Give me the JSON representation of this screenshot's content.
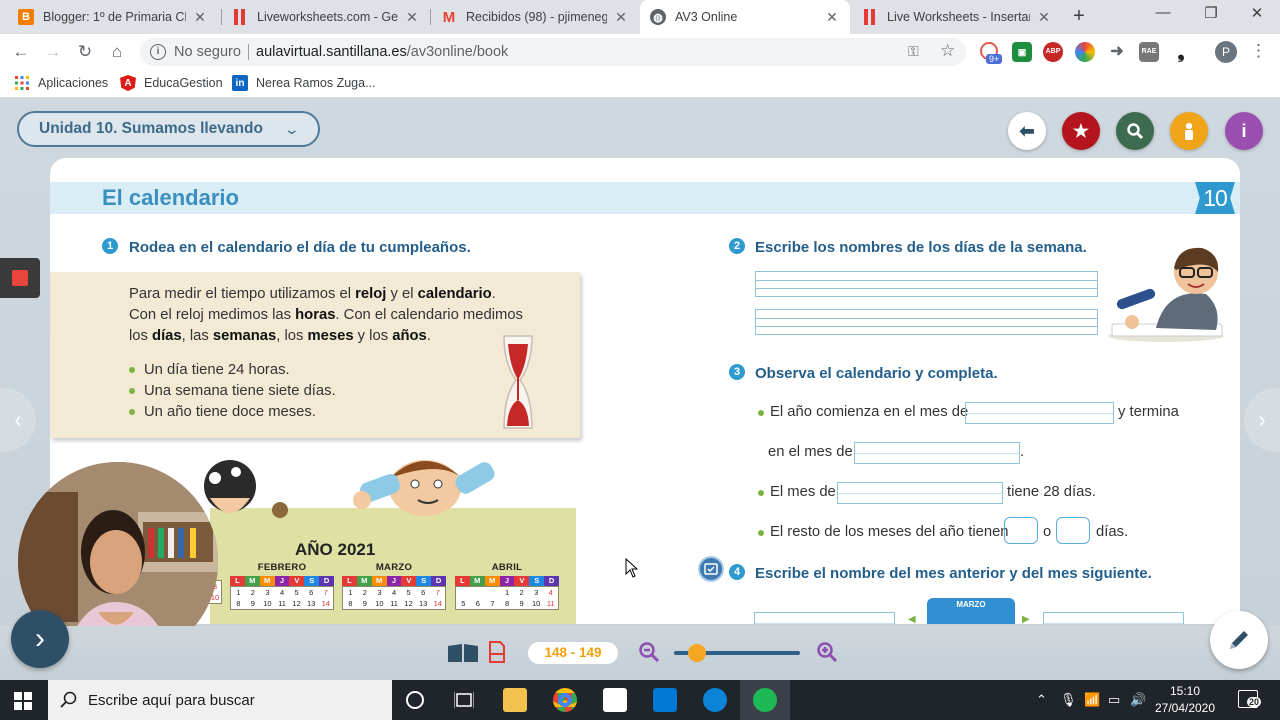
{
  "browser": {
    "tabs": [
      {
        "title": "Blogger: 1º de Primaria CP f",
        "favicon": "blogger-icon",
        "color": "#f57d00",
        "active": false
      },
      {
        "title": "Liveworksheets.com - Gene",
        "favicon": "liveworksheets-icon",
        "color": "#e53935",
        "active": false
      },
      {
        "title": "Recibidos (98) - pjimenegar",
        "favicon": "gmail-icon",
        "color": "#ea4335",
        "active": false
      },
      {
        "title": "AV3 Online",
        "favicon": "globe-icon",
        "color": "#5f6368",
        "active": true
      },
      {
        "title": "Live Worksheets - Insertar P",
        "favicon": "liveworksheets-icon",
        "color": "#e53935",
        "active": false
      }
    ],
    "address": {
      "security": "No seguro",
      "host": "aulavirtual.santillana.es",
      "path": "/av3online/book"
    },
    "extensions": {
      "badge": "9+",
      "abp": "ABP"
    },
    "profile_initial": "P",
    "bookmarks": [
      {
        "label": "Aplicaciones",
        "icon": "apps-grid-icon"
      },
      {
        "label": "EducaGestion",
        "icon": "angular-icon"
      },
      {
        "label": "Nerea Ramos Zuga...",
        "icon": "linkedin-icon"
      }
    ]
  },
  "app": {
    "unit_selector": "Unidad 10. Sumamos llevando",
    "top_buttons": [
      {
        "name": "back",
        "icon": "arrow-left-icon",
        "color": "#ffffff"
      },
      {
        "name": "favorites",
        "icon": "star-icon",
        "color": "#b3141d"
      },
      {
        "name": "search",
        "icon": "search-icon",
        "color": "#3d6b4f"
      },
      {
        "name": "user",
        "icon": "person-icon",
        "color": "#f0a418"
      },
      {
        "name": "info",
        "icon": "info-icon",
        "color": "#9b4fb0"
      }
    ],
    "page_title": "El calendario",
    "unit_number": "10",
    "exercises": {
      "ex1": {
        "number": "1",
        "prompt": "Rodea en el calendario el día de tu cumpleaños."
      },
      "ex2": {
        "number": "2",
        "prompt": "Escribe los nombres de los días de la semana."
      },
      "ex3": {
        "number": "3",
        "prompt": "Observa el calendario y completa.",
        "s1a": "El año comienza en el mes de",
        "s1b": "y termina",
        "s1c": "en el mes de",
        "s1d": ".",
        "s2a": "El mes de",
        "s2b": "tiene 28 días.",
        "s3a": "El resto de los meses del año tienen",
        "s3b": "o",
        "s3c": "días."
      },
      "ex4": {
        "number": "4",
        "prompt": "Escribe el nombre del mes anterior y del mes siguiente.",
        "mini_month": "MARZO"
      }
    },
    "info": {
      "l1a": "Para medir el tiempo utilizamos el ",
      "l1b": "reloj",
      "l1c": " y el ",
      "l1d": "calendario",
      "l1e": ".",
      "l2a": "Con el reloj medimos las ",
      "l2b": "horas",
      "l2c": ". Con el calendario medimos",
      "l3a": "los ",
      "l3b": "días",
      "l3c": ", las ",
      "l3d": "semanas",
      "l3e": ", los ",
      "l3f": "meses",
      "l3g": " y los ",
      "l3h": "años",
      "l3i": ".",
      "bullets": [
        "Un día tiene 24 horas.",
        "Una semana tiene siete días.",
        "Un año tiene doce meses."
      ]
    },
    "calendar": {
      "year": "AÑO 2021",
      "weekdays": [
        "L",
        "M",
        "M",
        "J",
        "V",
        "S",
        "D"
      ],
      "weekday_colors": [
        "#e53935",
        "#43a047",
        "#fb8c00",
        "#8e24aa",
        "#e53935",
        "#1e88e5",
        "#5e35b1"
      ],
      "months": [
        {
          "name": "FEBRERO",
          "rows": [
            [
              "1",
              "2",
              "3",
              "4",
              "5",
              "6",
              "7"
            ],
            [
              "8",
              "9",
              "10",
              "11",
              "12",
              "13",
              "14"
            ]
          ]
        },
        {
          "name": "MARZO",
          "rows": [
            [
              "1",
              "2",
              "3",
              "4",
              "5",
              "6",
              "7"
            ],
            [
              "8",
              "9",
              "10",
              "11",
              "12",
              "13",
              "14"
            ]
          ]
        },
        {
          "name": "ABRIL",
          "rows": [
            [
              "",
              "",
              "",
              "1",
              "2",
              "3",
              "4"
            ],
            [
              "5",
              "6",
              "7",
              "8",
              "9",
              "10",
              "11"
            ]
          ]
        }
      ],
      "partial_left": [
        "3",
        "10"
      ]
    },
    "bottom": {
      "pages": "148 - 149"
    }
  },
  "taskbar": {
    "search_placeholder": "Escribe aquí para buscar",
    "time": "15:10",
    "date": "27/04/2020",
    "notifications": "20"
  }
}
